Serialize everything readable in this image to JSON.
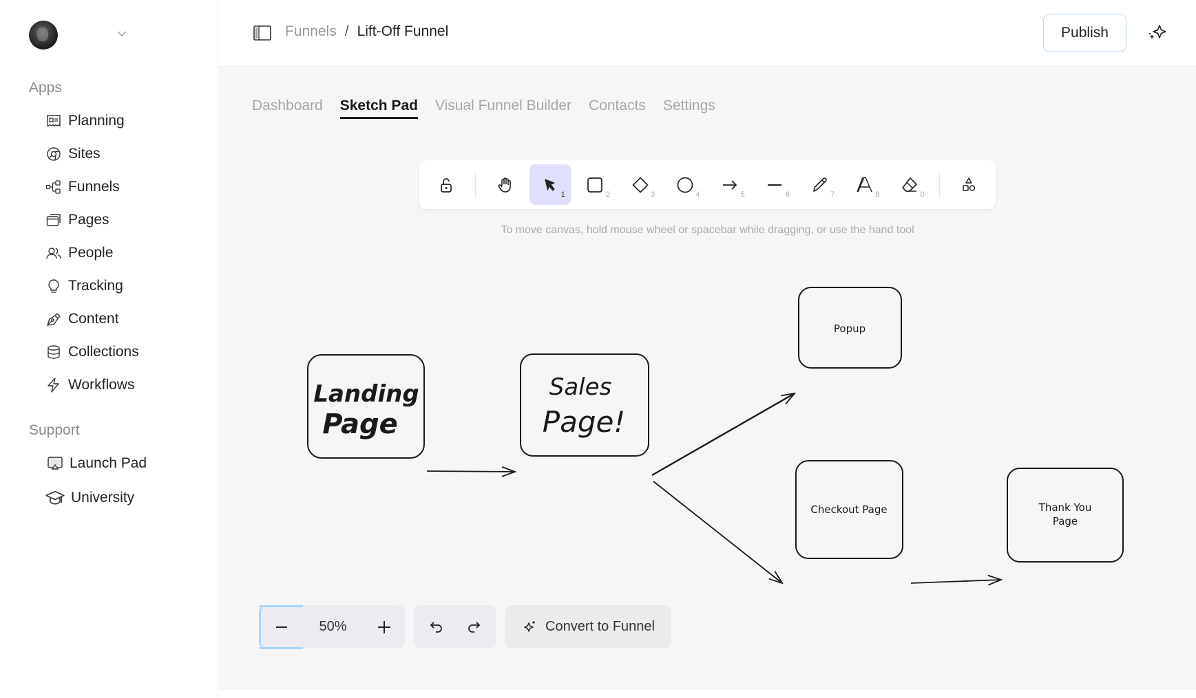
{
  "account": {
    "avatar_alt": "User avatar"
  },
  "sidebar": {
    "apps_label": "Apps",
    "apps": [
      {
        "label": "Planning",
        "icon": "planning-icon"
      },
      {
        "label": "Sites",
        "icon": "sites-icon"
      },
      {
        "label": "Funnels",
        "icon": "funnels-icon"
      },
      {
        "label": "Pages",
        "icon": "pages-icon"
      },
      {
        "label": "People",
        "icon": "people-icon"
      },
      {
        "label": "Tracking",
        "icon": "tracking-icon"
      },
      {
        "label": "Content",
        "icon": "content-icon"
      },
      {
        "label": "Collections",
        "icon": "collections-icon"
      },
      {
        "label": "Workflows",
        "icon": "workflows-icon"
      }
    ],
    "support_label": "Support",
    "support": [
      {
        "label": "Launch Pad",
        "icon": "launch-pad-icon"
      },
      {
        "label": "University",
        "icon": "university-icon"
      }
    ]
  },
  "header": {
    "breadcrumb": {
      "parent": "Funnels",
      "separator": "/",
      "current": "Lift-Off Funnel"
    },
    "publish_label": "Publish"
  },
  "tabs": [
    {
      "label": "Dashboard",
      "active": false
    },
    {
      "label": "Sketch Pad",
      "active": true
    },
    {
      "label": "Visual Funnel Builder",
      "active": false
    },
    {
      "label": "Contacts",
      "active": false
    },
    {
      "label": "Settings",
      "active": false
    }
  ],
  "toolbar": {
    "tools": [
      {
        "name": "lock",
        "key": ""
      },
      {
        "name": "hand",
        "key": ""
      },
      {
        "name": "select",
        "key": "1",
        "active": true
      },
      {
        "name": "rectangle",
        "key": "2"
      },
      {
        "name": "diamond",
        "key": "3"
      },
      {
        "name": "ellipse",
        "key": "4"
      },
      {
        "name": "arrow",
        "key": "5"
      },
      {
        "name": "line",
        "key": "6"
      },
      {
        "name": "pencil",
        "key": "7"
      },
      {
        "name": "text",
        "key": "8"
      },
      {
        "name": "eraser",
        "key": "0"
      },
      {
        "name": "shapes-library",
        "key": ""
      }
    ],
    "hint": "To move canvas, hold mouse wheel or spacebar while dragging, or use the hand tool"
  },
  "canvas": {
    "nodes": [
      {
        "id": "landing",
        "lines": [
          "Landing",
          "Page"
        ],
        "style": "handwritten-bold"
      },
      {
        "id": "sales",
        "lines": [
          "Sales",
          "Page!"
        ],
        "style": "handwritten"
      },
      {
        "id": "popup",
        "lines": [
          "Popup"
        ],
        "style": "sketch"
      },
      {
        "id": "checkout",
        "lines": [
          "Checkout Page"
        ],
        "style": "sketch"
      },
      {
        "id": "thankyou",
        "lines": [
          "Thank You",
          "Page"
        ],
        "style": "sketch"
      }
    ],
    "edges": [
      {
        "from": "landing",
        "to": "sales"
      },
      {
        "from": "sales",
        "to": "popup"
      },
      {
        "from": "sales",
        "to": "checkout"
      },
      {
        "from": "checkout",
        "to": "thankyou"
      }
    ]
  },
  "controls": {
    "zoom_level": "50%",
    "convert_label": "Convert to Funnel"
  }
}
